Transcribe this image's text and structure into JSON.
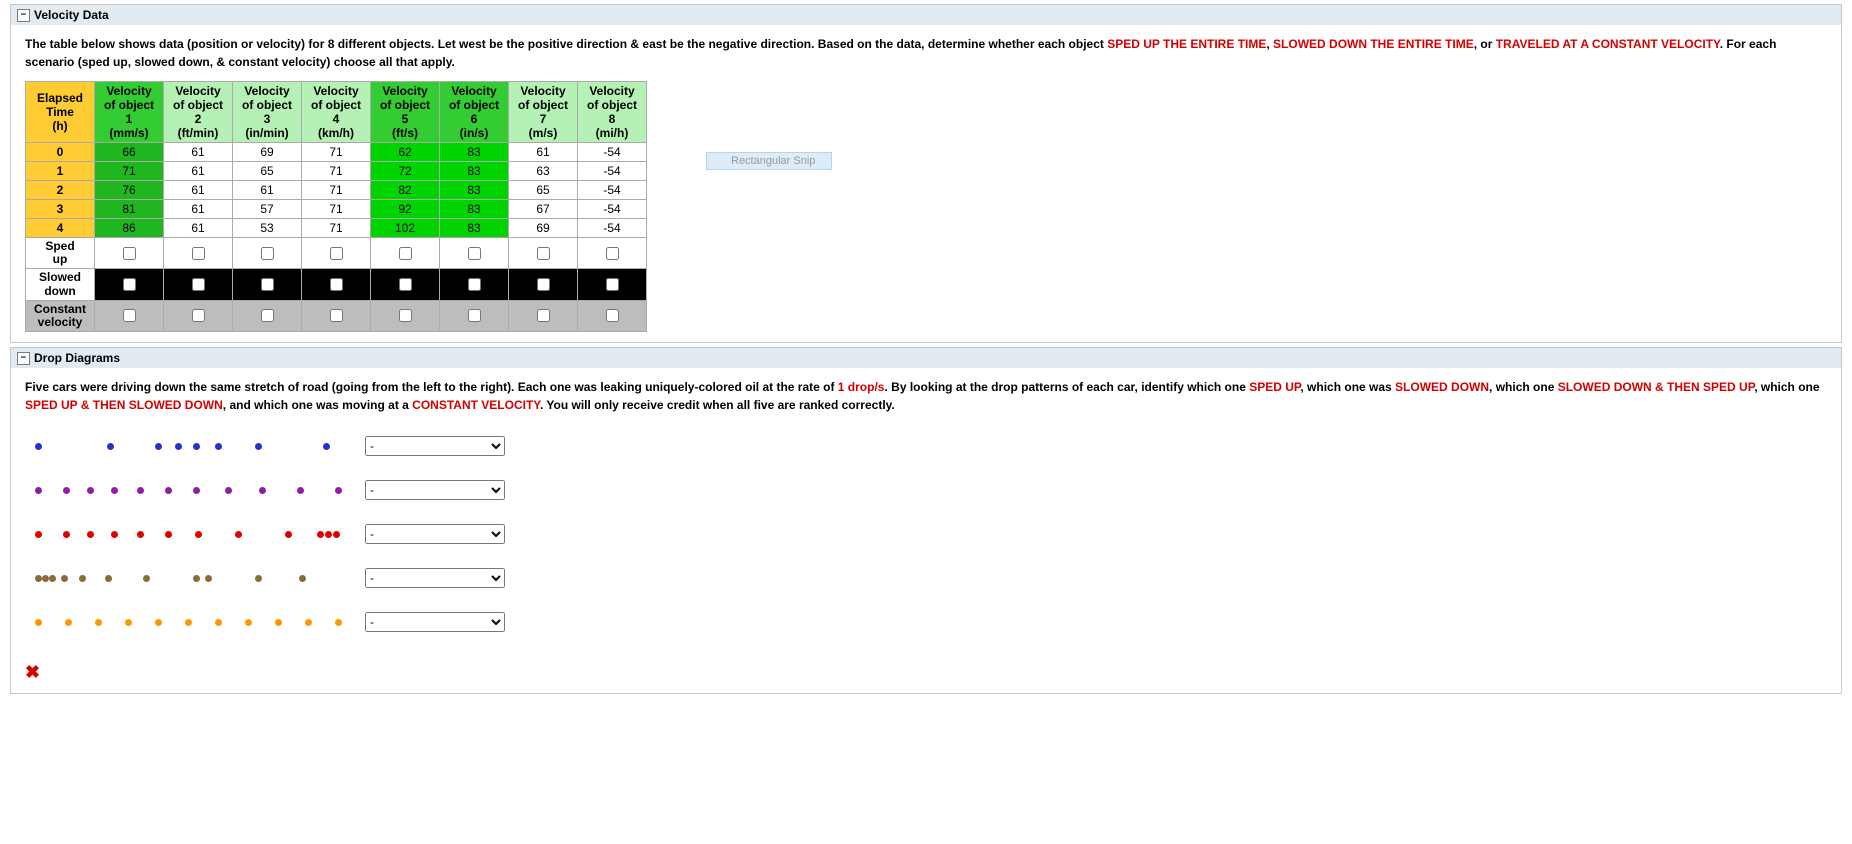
{
  "sections": {
    "velocity": {
      "title": "Velocity Data",
      "collapse_glyph": "−",
      "instr_parts": {
        "p1": "The table below shows data (position or velocity) for 8 different objects. Let west be the positive direction & east be the negative direction. Based on the data, determine whether each object ",
        "r1": "SPED UP THE ENTIRE TIME",
        "p2": ", ",
        "r2": "SLOWED DOWN THE ENTIRE TIME",
        "p3": ", or ",
        "r3": "TRAVELED AT A CONSTANT VELOCITY",
        "p4": ". For each scenario (sped up, slowed down, & constant velocity) choose all that apply."
      },
      "time_header_l1": "Elapsed",
      "time_header_l2": "Time",
      "time_header_l3": "(h)",
      "col_header_top": "Velocity",
      "col_header_mid": "of object",
      "columns": [
        {
          "num": "1",
          "unit": "(mm/s)",
          "hdr_class": "hdr-green",
          "cell_class": "cell-dgreen"
        },
        {
          "num": "2",
          "unit": "(ft/min)",
          "hdr_class": "hdr-lightgreen",
          "cell_class": "cell-plain"
        },
        {
          "num": "3",
          "unit": "(in/min)",
          "hdr_class": "hdr-lightgreen",
          "cell_class": "cell-plain"
        },
        {
          "num": "4",
          "unit": "(km/h)",
          "hdr_class": "hdr-lightgreen",
          "cell_class": "cell-plain"
        },
        {
          "num": "5",
          "unit": "(ft/s)",
          "hdr_class": "hdr-green",
          "cell_class": "cell-bgreen"
        },
        {
          "num": "6",
          "unit": "(in/s)",
          "hdr_class": "hdr-green",
          "cell_class": "cell-bgreen"
        },
        {
          "num": "7",
          "unit": "(m/s)",
          "hdr_class": "hdr-lightgreen",
          "cell_class": "cell-plain"
        },
        {
          "num": "8",
          "unit": "(mi/h)",
          "hdr_class": "hdr-lightgreen",
          "cell_class": "cell-plain"
        }
      ],
      "rows": [
        {
          "t": "0",
          "v": [
            "66",
            "61",
            "69",
            "71",
            "62",
            "83",
            "61",
            "-54"
          ]
        },
        {
          "t": "1",
          "v": [
            "71",
            "61",
            "65",
            "71",
            "72",
            "83",
            "63",
            "-54"
          ]
        },
        {
          "t": "2",
          "v": [
            "76",
            "61",
            "61",
            "71",
            "82",
            "83",
            "65",
            "-54"
          ]
        },
        {
          "t": "3",
          "v": [
            "81",
            "61",
            "57",
            "71",
            "92",
            "83",
            "67",
            "-54"
          ]
        },
        {
          "t": "4",
          "v": [
            "86",
            "61",
            "53",
            "71",
            "102",
            "83",
            "69",
            "-54"
          ]
        }
      ],
      "answer_rows": [
        {
          "label": "Sped up",
          "row_class": "row-spedup"
        },
        {
          "label": "Slowed down",
          "row_class": "row-slowed"
        },
        {
          "label": "Constant velocity",
          "row_class": "row-const"
        }
      ]
    },
    "drops": {
      "title": "Drop Diagrams",
      "collapse_glyph": "−",
      "instr_parts": {
        "p1": "Five cars were driving down the same stretch of road (going from the left to the right). Each one was leaking uniquely-colored oil at the rate of ",
        "r1": "1 drop/s",
        "p2": ". By looking at the drop patterns of each car, identify which one ",
        "r2": "SPED UP",
        "p3": ", which one was ",
        "r3": "SLOWED DOWN",
        "p4": ", which one ",
        "r4": "SLOWED DOWN & THEN SPED UP",
        "p5": ", which one ",
        "r5": "SPED UP & THEN SLOWED DOWN",
        "p6": ", and which one was moving at a ",
        "r6": "CONSTANT VELOCITY",
        "p7": ". You will only receive credit when all five are ranked correctly."
      },
      "select_placeholder": "-",
      "patterns": [
        {
          "color": "#2233cc",
          "x": [
            10,
            82,
            130,
            150,
            168,
            190,
            230,
            298
          ]
        },
        {
          "color": "#8a1fa0",
          "x": [
            10,
            38,
            62,
            86,
            112,
            140,
            168,
            200,
            234,
            272,
            310
          ]
        },
        {
          "color": "#e00000",
          "x": [
            10,
            38,
            62,
            86,
            112,
            140,
            170,
            210,
            260,
            292,
            300,
            308
          ]
        },
        {
          "color": "#8b6b3a",
          "x": [
            10,
            17,
            24,
            36,
            54,
            80,
            118,
            168,
            180,
            230,
            274
          ]
        },
        {
          "color": "#ff9800",
          "x": [
            10,
            40,
            70,
            100,
            130,
            160,
            190,
            220,
            250,
            280,
            310
          ]
        }
      ]
    }
  },
  "snip_label": "Rectangular Snip",
  "x_glyph": "✖"
}
